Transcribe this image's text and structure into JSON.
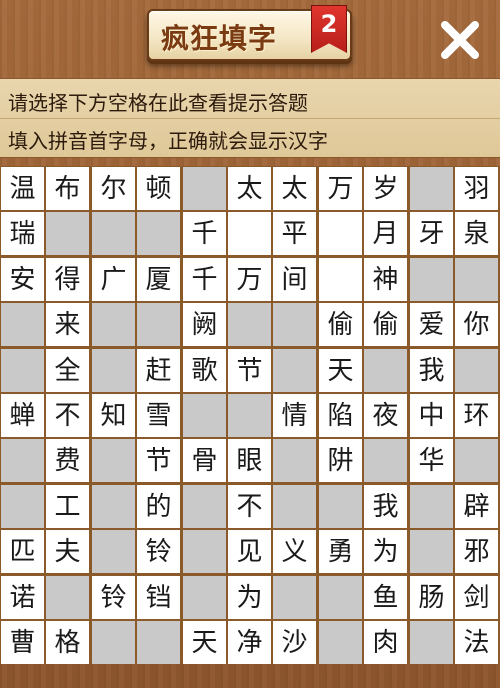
{
  "header": {
    "title": "疯狂填字",
    "badge": "2",
    "close_icon": "close-icon"
  },
  "hint": {
    "line1": "请选择下方空格在此查看提示答题",
    "line2": "填入拼音首字母，正确就会显示汉字"
  },
  "colors": {
    "background": "#9a5f33",
    "empty_cell": "#c9c9c9",
    "filled_cell": "#ffffff",
    "badge": "#cc2a24"
  },
  "grid": {
    "rows": [
      [
        "温",
        "布",
        "尔",
        "顿",
        "#",
        "太",
        "太",
        "万",
        "岁",
        "#",
        "羽"
      ],
      [
        "瑞",
        "#",
        "#",
        "#",
        "千",
        "",
        "平",
        "",
        "月",
        "牙",
        "泉"
      ],
      [
        "安",
        "得",
        "广",
        "厦",
        "千",
        "万",
        "间",
        "",
        "神",
        "#",
        "#"
      ],
      [
        "#",
        "来",
        "#",
        "#",
        "阙",
        "#",
        "#",
        "偷",
        "偷",
        "爱",
        "你"
      ],
      [
        "#",
        "全",
        "#",
        "赶",
        "歌",
        "节",
        "#",
        "天",
        "#",
        "我",
        "#"
      ],
      [
        "蝉",
        "不",
        "知",
        "雪",
        "#",
        "#",
        "情",
        "陷",
        "夜",
        "中",
        "环"
      ],
      [
        "#",
        "费",
        "#",
        "节",
        "骨",
        "眼",
        "#",
        "阱",
        "#",
        "华",
        "#"
      ],
      [
        "#",
        "工",
        "#",
        "的",
        "#",
        "不",
        "#",
        "#",
        "我",
        "#",
        "辟"
      ],
      [
        "匹",
        "夫",
        "#",
        "铃",
        "#",
        "见",
        "义",
        "勇",
        "为",
        "#",
        "邪"
      ],
      [
        "诺",
        "#",
        "铃",
        "铛",
        "#",
        "为",
        "#",
        "#",
        "鱼",
        "肠",
        "剑"
      ],
      [
        "曹",
        "格",
        "#",
        "#",
        "天",
        "净",
        "沙",
        "#",
        "肉",
        "#",
        "法"
      ]
    ]
  }
}
